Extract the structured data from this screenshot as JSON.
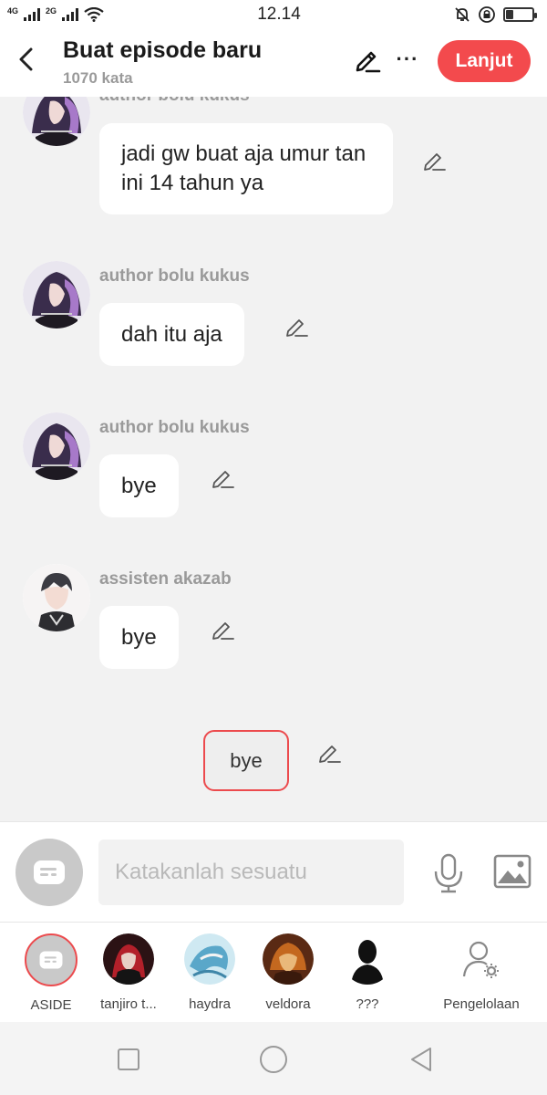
{
  "status_bar": {
    "network_1": "4G",
    "network_2": "2G",
    "time": "12.14",
    "icons": [
      "signal-icon",
      "wifi-icon",
      "mute-icon",
      "rotation-lock-icon",
      "battery-icon"
    ],
    "battery_level_fraction": 0.3
  },
  "header": {
    "title": "Buat episode baru",
    "word_count": "1070 kata",
    "next_label": "Lanjut",
    "more_glyph": "···",
    "accent_color": "#f34a4d"
  },
  "messages": [
    {
      "author": "author bolu kukus",
      "text": "jadi gw buat aja umur tan ini 14 tahun ya",
      "avatar": "author-avatar"
    },
    {
      "author": "author bolu kukus",
      "text": "dah itu aja",
      "avatar": "author-avatar"
    },
    {
      "author": "author bolu kukus",
      "text": "bye",
      "avatar": "author-avatar"
    },
    {
      "author": "assisten akazab",
      "text": "bye",
      "avatar": "assistant-avatar"
    }
  ],
  "aside_message": {
    "text": "bye"
  },
  "input": {
    "placeholder": "Katakanlah sesuatu",
    "value": ""
  },
  "characters": [
    {
      "label": "ASIDE",
      "selected": true
    },
    {
      "label": "tanjiro t..."
    },
    {
      "label": "haydra"
    },
    {
      "label": "veldora"
    },
    {
      "label": "???"
    },
    {
      "label": "Pengelolaan"
    }
  ]
}
